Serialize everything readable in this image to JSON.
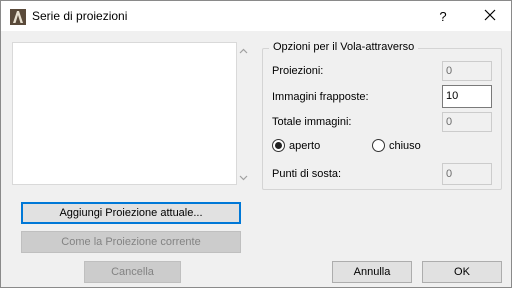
{
  "window": {
    "title": "Serie di proiezioni",
    "help_label": "?"
  },
  "options": {
    "group_title": "Opzioni per il Vola-attraverso",
    "proiezioni_label": "Proiezioni:",
    "proiezioni_value": "0",
    "immagini_frapposte_label": "Immagini frapposte:",
    "immagini_frapposte_value": "10",
    "totale_immagini_label": "Totale immagini:",
    "totale_immagini_value": "0",
    "aperto_label": "aperto",
    "chiuso_label": "chiuso",
    "selected_mode": "aperto",
    "punti_di_sosta_label": "Punti di sosta:",
    "punti_di_sosta_value": "0"
  },
  "buttons": {
    "aggiungi": "Aggiungi Proiezione attuale...",
    "come_la_proiezione": "Come la Proiezione corrente",
    "cancella": "Cancella",
    "annulla": "Annulla",
    "ok": "OK"
  },
  "icons": {
    "app": "archicad-icon",
    "close": "close-icon",
    "scroll_up": "chevron-up-icon",
    "scroll_down": "chevron-down-icon"
  },
  "colors": {
    "accent": "#0078d7",
    "dialog_bg": "#f0f0f0",
    "titlebar_bg": "#ffffff"
  }
}
